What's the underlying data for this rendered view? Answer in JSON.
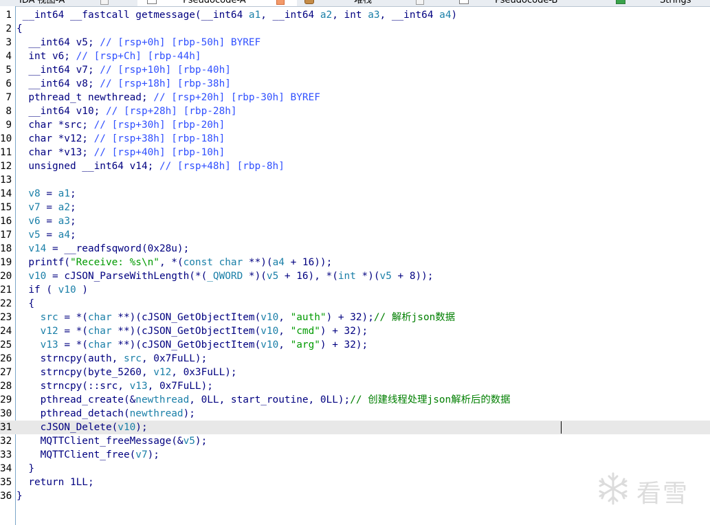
{
  "tabs": [
    {
      "label": "IDA 视图-A",
      "active": false,
      "icon": "ida-view-icon"
    },
    {
      "label": "Pseudocode-A",
      "active": true,
      "icon": "pseudocode-icon"
    },
    {
      "label": "堆栈",
      "active": false,
      "icon": "stack-icon"
    },
    {
      "label": "Pseudocode-B",
      "active": false,
      "icon": "pseudocode-icon"
    },
    {
      "label": "",
      "active": false,
      "icon": "green-icon"
    },
    {
      "label": "Strings",
      "active": false,
      "icon": "strings-icon"
    }
  ],
  "code_lines": [
    {
      "n": "1",
      "text": " __int64 __fastcall getmessage(__int64 a1, __int64 a2, int a3, __int64 a4)"
    },
    {
      "n": "2",
      "text": "{"
    },
    {
      "n": "3",
      "text": "  __int64 v5; // [rsp+0h] [rbp-50h] BYREF"
    },
    {
      "n": "4",
      "text": "  int v6; // [rsp+Ch] [rbp-44h]"
    },
    {
      "n": "5",
      "text": "  __int64 v7; // [rsp+10h] [rbp-40h]"
    },
    {
      "n": "6",
      "text": "  __int64 v8; // [rsp+18h] [rbp-38h]"
    },
    {
      "n": "7",
      "text": "  pthread_t newthread; // [rsp+20h] [rbp-30h] BYREF"
    },
    {
      "n": "8",
      "text": "  __int64 v10; // [rsp+28h] [rbp-28h]"
    },
    {
      "n": "9",
      "text": "  char *src; // [rsp+30h] [rbp-20h]"
    },
    {
      "n": "10",
      "text": "  char *v12; // [rsp+38h] [rbp-18h]"
    },
    {
      "n": "11",
      "text": "  char *v13; // [rsp+40h] [rbp-10h]"
    },
    {
      "n": "12",
      "text": "  unsigned __int64 v14; // [rsp+48h] [rbp-8h]"
    },
    {
      "n": "13",
      "text": ""
    },
    {
      "n": "14",
      "text": "  v8 = a1;"
    },
    {
      "n": "15",
      "text": "  v7 = a2;"
    },
    {
      "n": "16",
      "text": "  v6 = a3;"
    },
    {
      "n": "17",
      "text": "  v5 = a4;"
    },
    {
      "n": "18",
      "text": "  v14 = __readfsqword(0x28u);"
    },
    {
      "n": "19",
      "text": "  printf(\"Receive: %s\\n\", *(const char **)(a4 + 16));"
    },
    {
      "n": "20",
      "text": "  v10 = cJSON_ParseWithLength(*(_QWORD *)(v5 + 16), *(int *)(v5 + 8));"
    },
    {
      "n": "21",
      "text": "  if ( v10 )"
    },
    {
      "n": "22",
      "text": "  {"
    },
    {
      "n": "23",
      "text": "    src = *(char **)(cJSON_GetObjectItem(v10, \"auth\") + 32);// 解析json数据"
    },
    {
      "n": "24",
      "text": "    v12 = *(char **)(cJSON_GetObjectItem(v10, \"cmd\") + 32);"
    },
    {
      "n": "25",
      "text": "    v13 = *(char **)(cJSON_GetObjectItem(v10, \"arg\") + 32);"
    },
    {
      "n": "26",
      "text": "    strncpy(auth, src, 0x7FuLL);"
    },
    {
      "n": "27",
      "text": "    strncpy(byte_5260, v12, 0x3FuLL);"
    },
    {
      "n": "28",
      "text": "    strncpy(::src, v13, 0x7FuLL);"
    },
    {
      "n": "29",
      "text": "    pthread_create(&newthread, 0LL, start_routine, 0LL);// 创建线程处理json解析后的数据"
    },
    {
      "n": "30",
      "text": "    pthread_detach(newthread);"
    },
    {
      "n": "31",
      "text": "    cJSON_Delete(v10);",
      "current": true
    },
    {
      "n": "32",
      "text": "    MQTTClient_freeMessage(&v5);"
    },
    {
      "n": "33",
      "text": "    MQTTClient_free(v7);"
    },
    {
      "n": "34",
      "text": "  }"
    },
    {
      "n": "35",
      "text": "  return 1LL;"
    },
    {
      "n": "36",
      "text": "}"
    }
  ],
  "watermark": {
    "text": "看雪",
    "icon": "snowflake-logo-icon"
  },
  "colors": {
    "keyword": "#000080",
    "comment": "#3050ff",
    "local_var": "#1a7fa8",
    "string": "#009a00",
    "chinese_comment": "#007f00",
    "gutter_border": "#7aa6c8",
    "current_line": "#e8e8e8"
  }
}
